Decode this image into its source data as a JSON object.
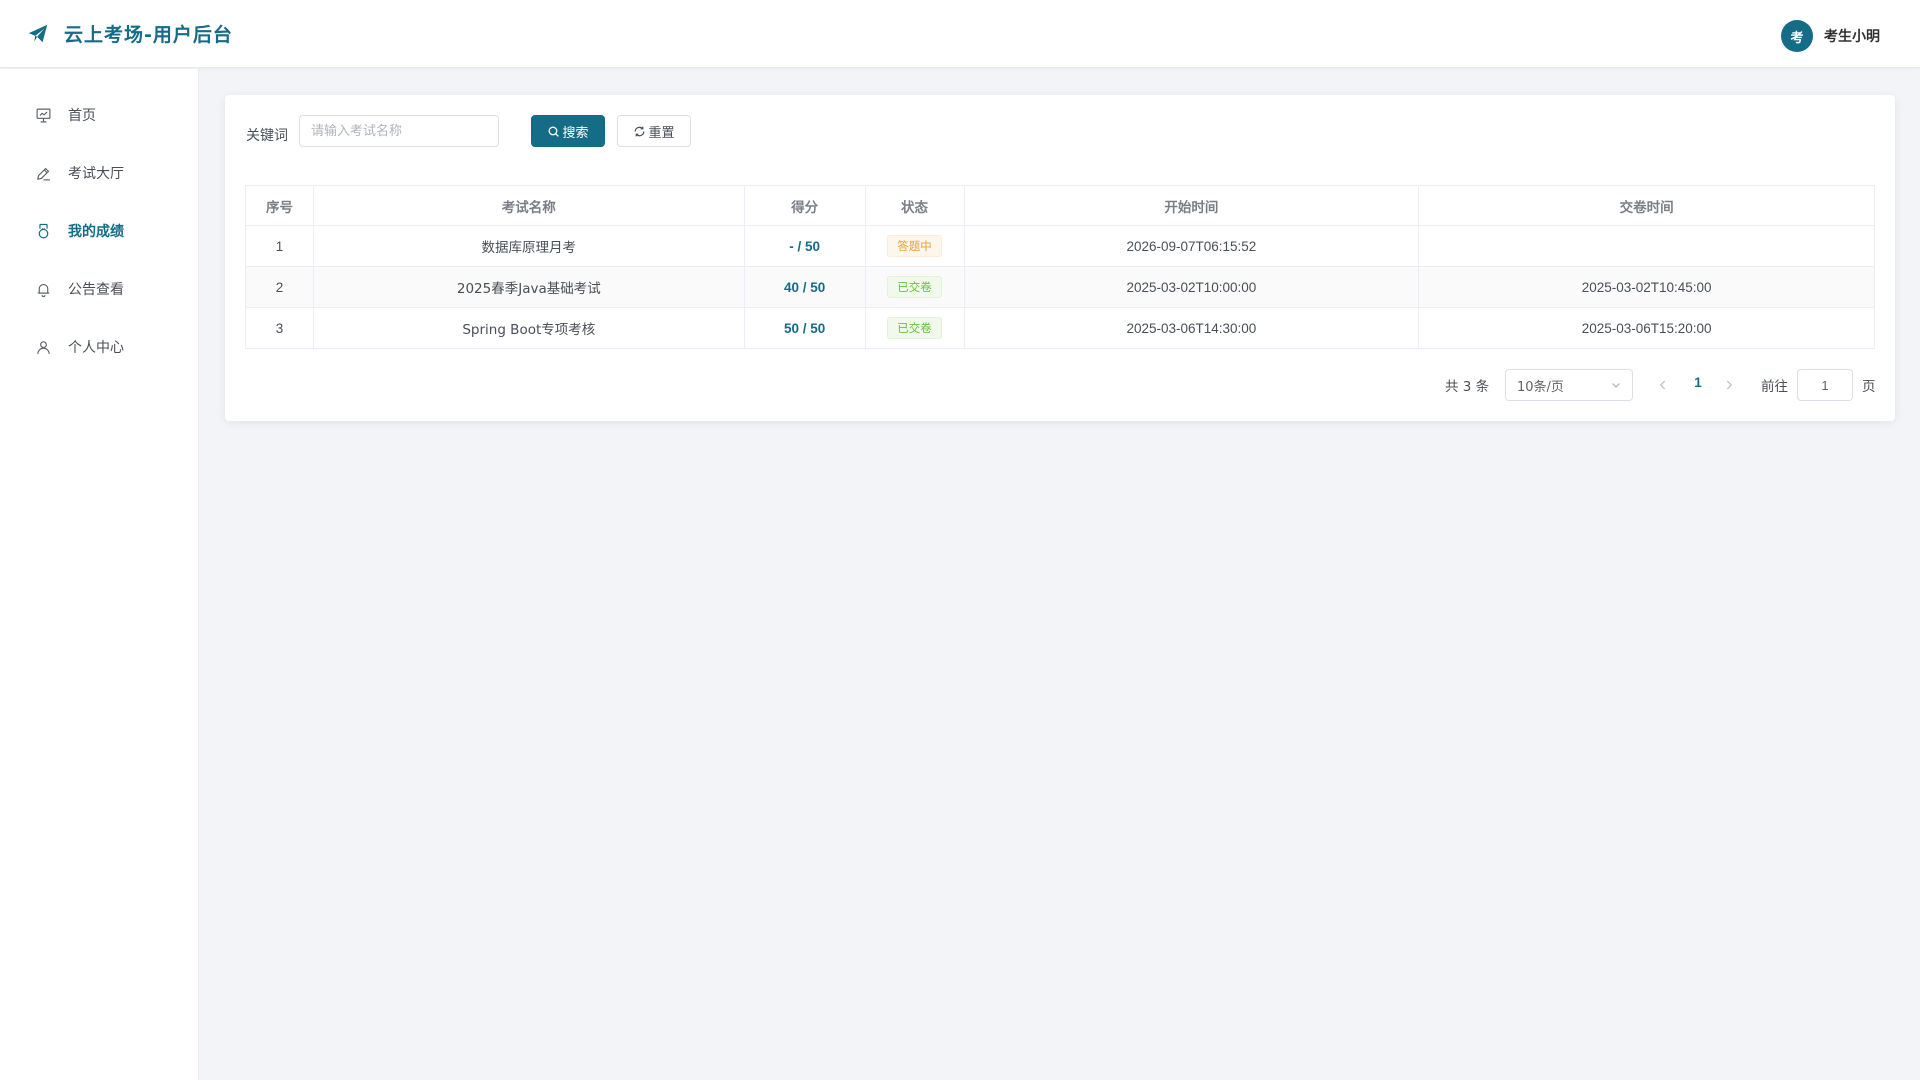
{
  "header": {
    "title": "云上考场-用户后台",
    "avatar_text": "考",
    "username": "考生小明",
    "brand_icon": "paper-plane-icon"
  },
  "sidebar": {
    "items": [
      {
        "label": "首页",
        "icon": "presentation-chart-icon",
        "active": false
      },
      {
        "label": "考试大厅",
        "icon": "pen-edit-icon",
        "active": false
      },
      {
        "label": "我的成绩",
        "icon": "medal-icon",
        "active": true
      },
      {
        "label": "公告查看",
        "icon": "bell-icon",
        "active": false
      },
      {
        "label": "个人中心",
        "icon": "user-icon",
        "active": false
      }
    ]
  },
  "filter": {
    "keyword_label": "关键词",
    "keyword_placeholder": "请输入考试名称",
    "keyword_value": "",
    "search_label": "搜索",
    "reset_label": "重置"
  },
  "table": {
    "columns": [
      "序号",
      "考试名称",
      "得分",
      "状态",
      "开始时间",
      "交卷时间"
    ],
    "rows": [
      {
        "index": "1",
        "name": "数据库原理月考",
        "score": "- / 50",
        "status": "答题中",
        "status_type": "warning",
        "start": "2026-09-07T06:15:52",
        "submit": ""
      },
      {
        "index": "2",
        "name": "2025春季Java基础考试",
        "score": "40 / 50",
        "status": "已交卷",
        "status_type": "success",
        "start": "2025-03-02T10:00:00",
        "submit": "2025-03-02T10:45:00"
      },
      {
        "index": "3",
        "name": "Spring Boot专项考核",
        "score": "50 / 50",
        "status": "已交卷",
        "status_type": "success",
        "start": "2025-03-06T14:30:00",
        "submit": "2025-03-06T15:20:00"
      }
    ]
  },
  "pagination": {
    "total_text": "共 3 条",
    "page_size": "10条/页",
    "current_page": "1",
    "goto_label": "前往",
    "goto_value": "1",
    "goto_suffix": "页"
  },
  "colors": {
    "accent": "#146c87",
    "warning": "#e6a23c",
    "success": "#67c23a"
  }
}
